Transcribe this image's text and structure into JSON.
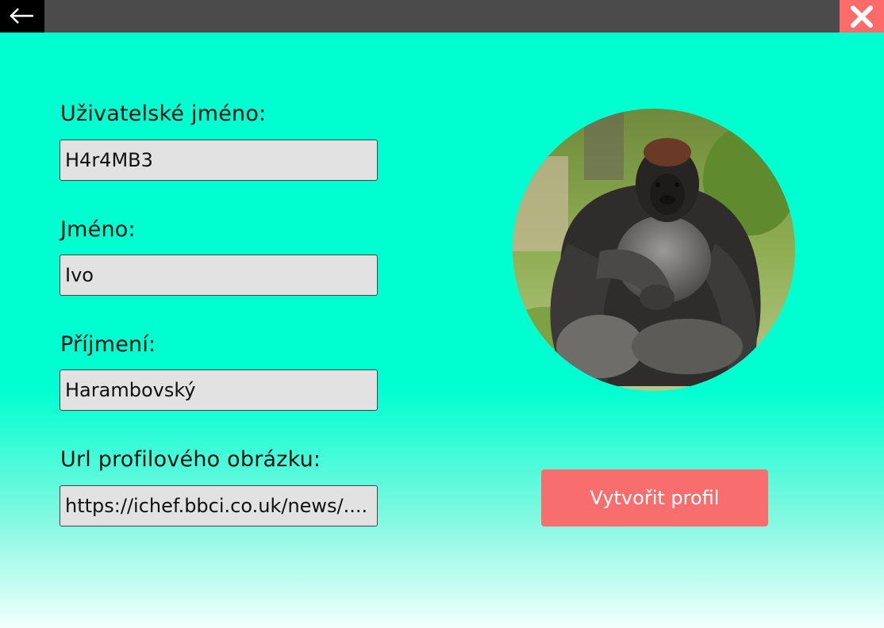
{
  "form": {
    "username_label": "Uživatelské jméno:",
    "username_value": "H4r4MB3",
    "firstname_label": "Jméno:",
    "firstname_value": "Ivo",
    "lastname_label": "Příjmení:",
    "lastname_value": "Harambovský",
    "url_label": "Url profilového obrázku:",
    "url_value": "https://ichef.bbci.co.uk/news/...."
  },
  "actions": {
    "create_label": "Vytvořit profil"
  },
  "icons": {
    "back": "arrow-left-icon",
    "close": "close-icon",
    "avatar": "gorilla-photo"
  },
  "colors": {
    "background": "#00ffd0",
    "topbar": "#4b4b4b",
    "close": "#ff6b6b",
    "button": "#f86d6d"
  }
}
